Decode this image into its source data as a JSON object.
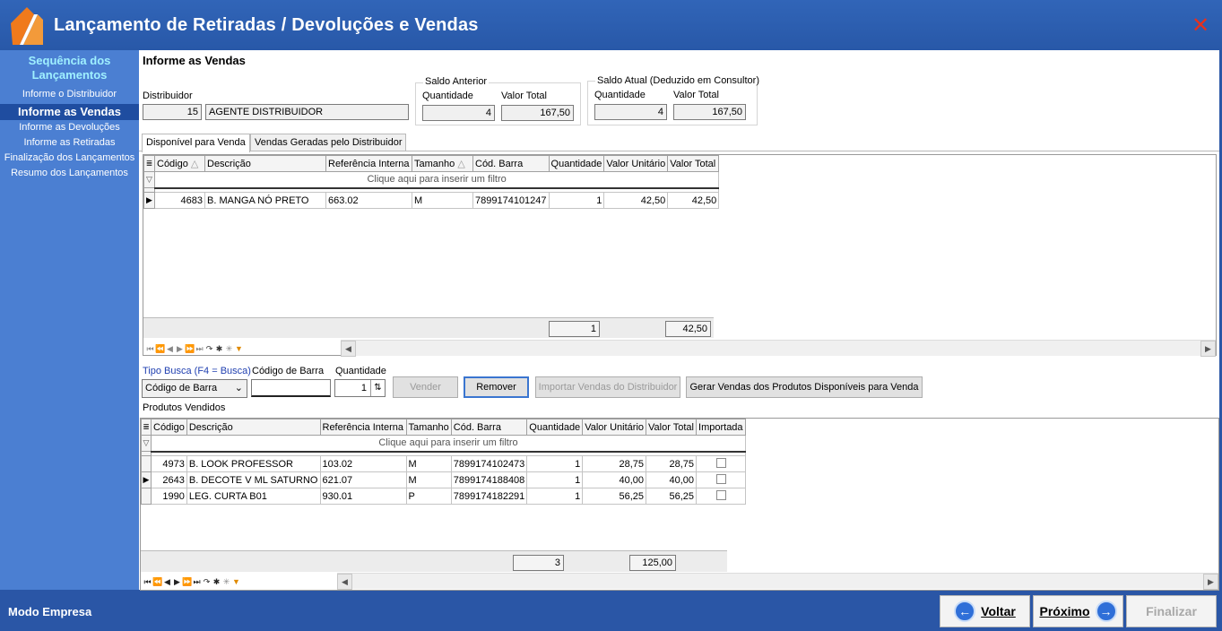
{
  "window": {
    "title": "Lançamento de Retiradas / Devoluções e Vendas"
  },
  "sidebar": {
    "title_line1": "Sequência dos",
    "title_line2": "Lançamentos",
    "items": [
      {
        "label": "Informe o Distribuidor"
      },
      {
        "label": "Informe as Vendas"
      },
      {
        "label": "Informe as Devoluções"
      },
      {
        "label": "Informe as Retiradas"
      },
      {
        "label": "Finalização dos Lançamentos"
      },
      {
        "label": "Resumo dos Lançamentos"
      }
    ],
    "mode": "Modo Empresa"
  },
  "header": {
    "title": "Informe as Vendas",
    "distribuidor_label": "Distribuidor",
    "distribuidor_code": "15",
    "distribuidor_name": "AGENTE DISTRIBUIDOR",
    "saldo_anterior": {
      "title": "Saldo Anterior",
      "qtd_label": "Quantidade",
      "total_label": "Valor Total",
      "qtd": "4",
      "total": "167,50"
    },
    "saldo_atual": {
      "title": "Saldo Atual (Deduzido em Consultor)",
      "qtd_label": "Quantidade",
      "total_label": "Valor Total",
      "qtd": "4",
      "total": "167,50"
    }
  },
  "tabs": [
    {
      "label": "Disponível para Venda"
    },
    {
      "label": "Vendas Geradas pelo Distribuidor"
    }
  ],
  "grid1": {
    "columns": [
      "Código",
      "Descrição",
      "Referência Interna",
      "Tamanho",
      "Cód. Barra",
      "Quantidade",
      "Valor Unitário",
      "Valor Total"
    ],
    "filter_text": "Clique aqui para inserir um filtro",
    "rows": [
      {
        "codigo": "4683",
        "descricao": "B. MANGA NÓ PRETO",
        "ref": "663.02",
        "tam": "M",
        "barra": "7899174101247",
        "qtd": "1",
        "unit": "42,50",
        "total": "42,50"
      }
    ],
    "footer_qtd": "1",
    "footer_total": "42,50"
  },
  "search": {
    "tipo_label": "Tipo Busca (F4 = Busca)",
    "tipo_value": "Código de Barra",
    "barra_label": "Código de Barra",
    "barra_value": "",
    "qtd_label": "Quantidade",
    "qtd_value": "1"
  },
  "buttons": {
    "vender": "Vender",
    "remover": "Remover",
    "importar": "Importar Vendas do Distribuidor",
    "gerar": "Gerar Vendas dos Produtos Disponíveis para Venda"
  },
  "grid2": {
    "caption": "Produtos Vendidos",
    "columns": [
      "Código",
      "Descrição",
      "Referência Interna",
      "Tamanho",
      "Cód. Barra",
      "Quantidade",
      "Valor Unitário",
      "Valor Total",
      "Importada"
    ],
    "filter_text": "Clique aqui para inserir um filtro",
    "rows": [
      {
        "codigo": "4973",
        "descricao": "B. LOOK PROFESSOR",
        "ref": "103.02",
        "tam": "M",
        "barra": "7899174102473",
        "qtd": "1",
        "unit": "28,75",
        "total": "28,75",
        "importada": false
      },
      {
        "codigo": "2643",
        "descricao": "B. DECOTE V ML SATURNO",
        "ref": "621.07",
        "tam": "M",
        "barra": "7899174188408",
        "qtd": "1",
        "unit": "40,00",
        "total": "40,00",
        "importada": false
      },
      {
        "codigo": "1990",
        "descricao": "LEG. CURTA B01",
        "ref": "930.01",
        "tam": "P",
        "barra": "7899174182291",
        "qtd": "1",
        "unit": "56,25",
        "total": "56,25",
        "importada": false
      }
    ],
    "footer_qtd": "3",
    "footer_total": "125,00"
  },
  "nav": {
    "voltar": "Voltar",
    "proximo": "Próximo",
    "finalizar": "Finalizar"
  },
  "colors": {
    "titlebar": "#2d5fb0",
    "sidebar": "#4b7fd2",
    "sidebar_active": "#1f4da0",
    "close": "#e8301c",
    "accent": "#2f6fd8"
  }
}
